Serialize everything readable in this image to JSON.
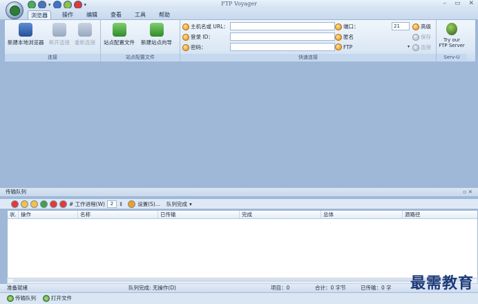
{
  "window": {
    "title": "FTP Voyager",
    "minimize": "–",
    "maximize": "▭",
    "close": "✕"
  },
  "tabs": [
    "浏览器",
    "操作",
    "编辑",
    "查看",
    "工具",
    "帮助"
  ],
  "ribbon": {
    "connect_group": {
      "label": "连接",
      "new_local": "新建本地浏览器",
      "disconnect": "断开连接",
      "reconnect": "重新连接"
    },
    "site_group": {
      "label": "站点配置文件",
      "site_profile": "站点配置文件",
      "new_site_wizard": "新建站点向导"
    },
    "quick_connect": {
      "label": "快速连接",
      "host_label": "主机名或 URL：",
      "login_label": "登录 ID：",
      "password_label": "密码：",
      "port_label": "端口：",
      "port_value": "21",
      "anon_label": "匿名",
      "ftp_label": "FTP",
      "advanced": "高级",
      "save": "保存",
      "connect": "连接"
    },
    "servu": {
      "label": "Serv-U",
      "button": "Try our FTP Server"
    }
  },
  "queue": {
    "title": "传输队列",
    "threads_label": "# 工作进程(W)",
    "threads_value": "2",
    "settings": "设置(S)...",
    "queue_done": "队列完成",
    "columns": [
      "状.",
      "操作",
      "名称",
      "已传输",
      "完成",
      "总体",
      "源路径"
    ]
  },
  "status": {
    "ready": "准备就绪",
    "queue_done": "队列完成: 无操作(D)",
    "items": "项目：0",
    "total": "合计：0 字节",
    "transferred": "已传输：0 字"
  },
  "taskbar": {
    "transfer_queue": "传输队列",
    "open_file": "打开文件"
  },
  "watermark": "最需教育",
  "colors": {
    "background": "#9fb8d8",
    "ribbon": "#dce8f5"
  }
}
